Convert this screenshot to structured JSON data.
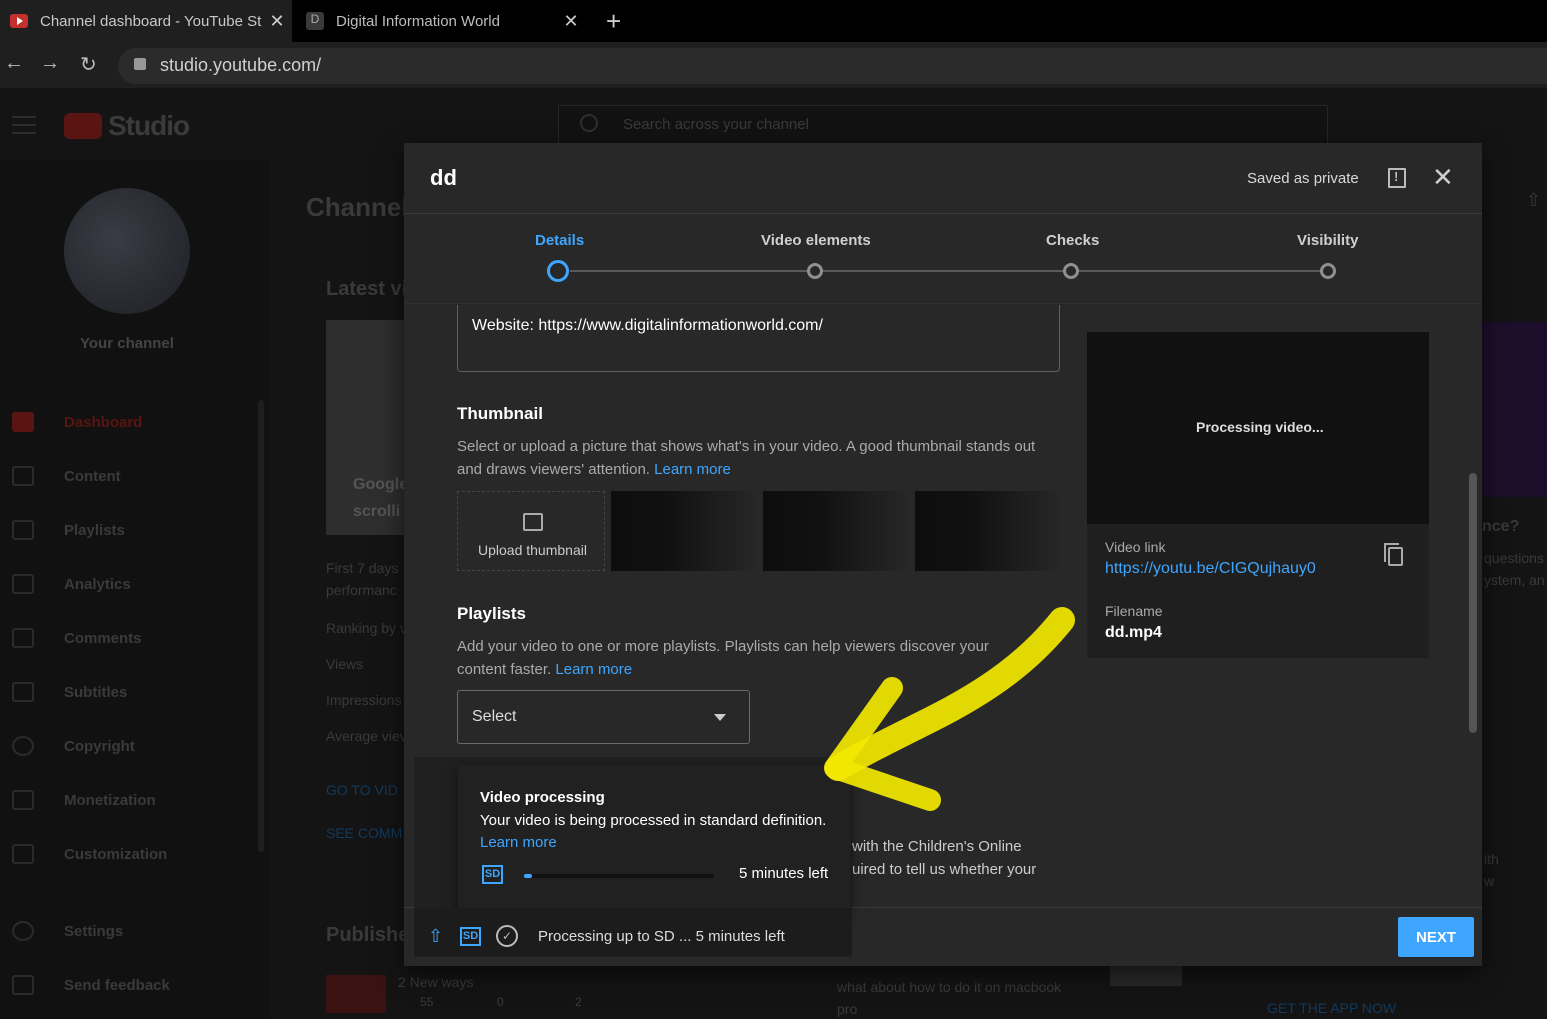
{
  "browser": {
    "tabs": [
      {
        "title": "Channel dashboard - YouTube St",
        "active": true
      },
      {
        "title": "Digital Information World",
        "favicon_letter": "D",
        "active": false
      }
    ],
    "url": "studio.youtube.com/"
  },
  "studio": {
    "logo_text": "Studio",
    "search_placeholder": "Search across your channel",
    "your_channel": "Your channel",
    "sidebar": [
      {
        "label": "Dashboard",
        "icon": "dashboard-icon",
        "active": true
      },
      {
        "label": "Content",
        "icon": "content-icon"
      },
      {
        "label": "Playlists",
        "icon": "playlists-icon"
      },
      {
        "label": "Analytics",
        "icon": "analytics-icon"
      },
      {
        "label": "Comments",
        "icon": "comments-icon"
      },
      {
        "label": "Subtitles",
        "icon": "subtitles-icon"
      },
      {
        "label": "Copyright",
        "icon": "copyright-icon"
      },
      {
        "label": "Monetization",
        "icon": "monetization-icon"
      },
      {
        "label": "Customization",
        "icon": "customization-icon"
      },
      {
        "label": "Settings",
        "icon": "settings-icon"
      },
      {
        "label": "Send feedback",
        "icon": "feedback-icon"
      }
    ],
    "bg": {
      "page_title": "Channel",
      "latest": "Latest vi",
      "first7": "First 7 days",
      "performance": "performanc",
      "ranking": "Ranking by v",
      "views": "Views",
      "impressions": "Impressions",
      "average": "Average viev",
      "go_to": "GO TO VID",
      "see_comm": "SEE COMM",
      "published": "Publishe",
      "pub_title": "2 New ways",
      "pub_views": "55",
      "pub_comments": "0",
      "pub_likes": "2",
      "comment_text1": "what about how to do it on macbook",
      "comment_text2": "pro",
      "right_title": "nce?",
      "right_p1": "questions",
      "right_p2": "ystem, an",
      "right_p3": "ith",
      "right_p4": "w",
      "get_app": "GET THE APP NOW",
      "thumb_text1": "Google",
      "thumb_text2": "scrolli"
    }
  },
  "modal": {
    "title": "dd",
    "saved_status": "Saved as private",
    "steps": [
      {
        "label": "Details",
        "active": true
      },
      {
        "label": "Video elements"
      },
      {
        "label": "Checks"
      },
      {
        "label": "Visibility"
      }
    ],
    "description_line": "Website: https://www.digitalinformationworld.com/",
    "thumbnail": {
      "heading": "Thumbnail",
      "text": "Select or upload a picture that shows what's in your video. A good thumbnail stands out and draws viewers' attention.",
      "learn_more": "Learn more",
      "upload_label": "Upload thumbnail"
    },
    "playlists": {
      "heading": "Playlists",
      "text": "Add your video to one or more playlists. Playlists can help viewers discover your content faster.",
      "learn_more": "Learn more",
      "select_label": "Select"
    },
    "preview": {
      "processing_text": "Processing video...",
      "video_link_label": "Video link",
      "video_link": "https://youtu.be/CIGQujhauy0",
      "filename_label": "Filename",
      "filename": "dd.mp4"
    },
    "coppa_line1": "with the Children's Online",
    "coppa_line2": "uired to tell us whether your",
    "next_label": "NEXT",
    "processing_popup": {
      "title": "Video processing",
      "desc": "Your video is being processed in standard definition.",
      "learn_more": "Learn more",
      "badge": "SD",
      "time_left": "5 minutes left",
      "progress": 0.04
    },
    "footer_status": "Processing up to SD ... 5 minutes left",
    "footer_badge": "SD"
  },
  "colors": {
    "accent": "#3ea6ff",
    "annotation": "#f2e800"
  }
}
